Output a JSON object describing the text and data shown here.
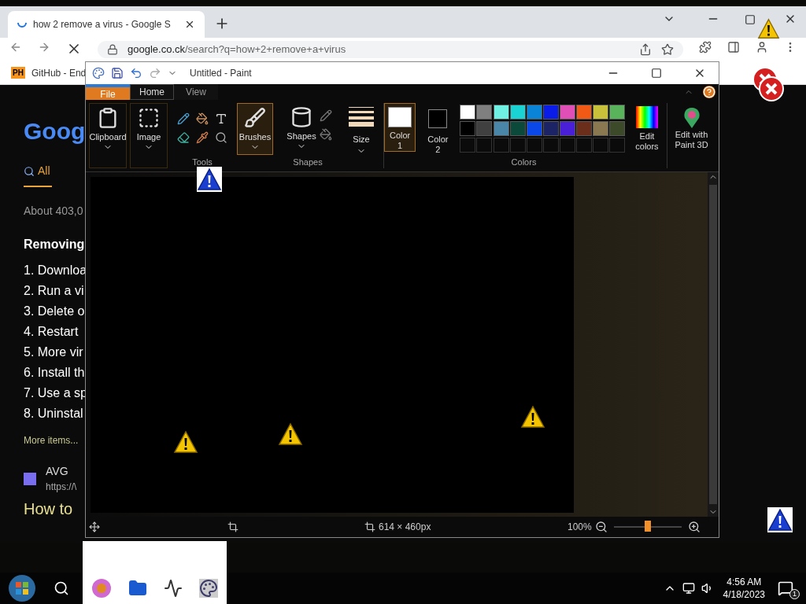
{
  "browser": {
    "tab_title": "how 2 remove a virus - Google S",
    "url_host": "google.co.ck",
    "url_path": "/search?q=how+2+remove+a+virus",
    "bookmark": "GitHub - End",
    "bookmark_badge": "PH",
    "page": {
      "logo": "Goog",
      "search_tab": "All",
      "result_count": "About 403,0",
      "heading": "Removing",
      "items": [
        "1. Downloa",
        "2. Run a vi",
        "3. Delete o",
        "4. Restart",
        "5. More vir",
        "6. Install th",
        "7. Use a sp",
        "8. Uninstal"
      ],
      "more": "More items...",
      "source_name": "AVG",
      "source_url": "https://\\",
      "result_title": "How to"
    }
  },
  "paint": {
    "title": "Untitled - Paint",
    "menu_tabs": [
      {
        "label": "File",
        "kind": "file",
        "selected": false
      },
      {
        "label": "Home",
        "kind": "tab",
        "selected": true
      },
      {
        "label": "View",
        "kind": "tab",
        "selected": false
      }
    ],
    "clipboard": "Clipboard",
    "image": "Image",
    "tools_label": "Tools",
    "brushes": "Brushes",
    "shapes": "Shapes",
    "shapes_label": "Shapes",
    "size": "Size",
    "color1": [
      "Color",
      "1"
    ],
    "color2": [
      "Color",
      "2"
    ],
    "colors_label": "Colors",
    "edit_colors": [
      "Edit",
      "colors"
    ],
    "paint3d": [
      "Edit with",
      "Paint 3D"
    ],
    "palette": [
      {
        "color": "#ffffff"
      },
      {
        "color": "#7f7f7f"
      },
      {
        "color": "#6ff2e4"
      },
      {
        "color": "#1ad3d3"
      },
      {
        "color": "#0a84d6"
      },
      {
        "color": "#0a1de8"
      },
      {
        "color": "#e04fb5"
      },
      {
        "color": "#f05a14"
      },
      {
        "color": "#c8c23a"
      },
      {
        "color": "#59b35a"
      },
      {
        "color": "#000000"
      },
      {
        "color": "#404040"
      },
      {
        "color": "#4a86a8"
      },
      {
        "color": "#0b4a3a"
      },
      {
        "color": "#0a48e8"
      },
      {
        "color": "#1c2466"
      },
      {
        "color": "#4a1fd8"
      },
      {
        "color": "#6b2e1a"
      },
      {
        "color": "#8a7850"
      },
      {
        "color": "#3d4a2a"
      }
    ],
    "status_size": "614 × 460px",
    "zoom": "100%",
    "zoom_slider": {
      "level": 0.5
    }
  },
  "taskbar": {
    "time": "4:56 AM",
    "date": "4/18/2023",
    "notifications": "1"
  }
}
